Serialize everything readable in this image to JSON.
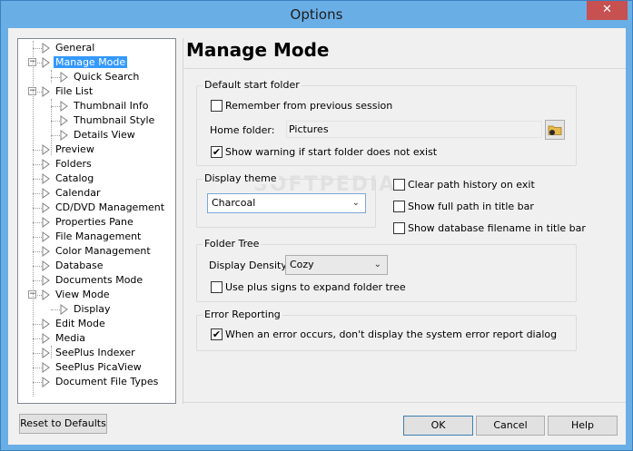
{
  "window": {
    "title": "Options",
    "close_glyph": "✕"
  },
  "tree": [
    {
      "label": "General",
      "level": 0
    },
    {
      "label": "Manage Mode",
      "level": 0,
      "selected": true,
      "expanded": true
    },
    {
      "label": "Quick Search",
      "level": 1
    },
    {
      "label": "File List",
      "level": 0,
      "expanded": true
    },
    {
      "label": "Thumbnail Info",
      "level": 1
    },
    {
      "label": "Thumbnail Style",
      "level": 1
    },
    {
      "label": "Details View",
      "level": 1
    },
    {
      "label": "Preview",
      "level": 0
    },
    {
      "label": "Folders",
      "level": 0
    },
    {
      "label": "Catalog",
      "level": 0
    },
    {
      "label": "Calendar",
      "level": 0
    },
    {
      "label": "CD/DVD Management",
      "level": 0
    },
    {
      "label": "Properties Pane",
      "level": 0
    },
    {
      "label": "File Management",
      "level": 0
    },
    {
      "label": "Color Management",
      "level": 0
    },
    {
      "label": "Database",
      "level": 0
    },
    {
      "label": "Documents Mode",
      "level": 0
    },
    {
      "label": "View Mode",
      "level": 0,
      "expanded": true
    },
    {
      "label": "Display",
      "level": 1
    },
    {
      "label": "Edit Mode",
      "level": 0
    },
    {
      "label": "Media",
      "level": 0
    },
    {
      "label": "SeePlus Indexer",
      "level": 0
    },
    {
      "label": "SeePlus PicaView",
      "level": 0
    },
    {
      "label": "Document File Types",
      "level": 0
    }
  ],
  "panel": {
    "heading": "Manage Mode",
    "start_folder": {
      "title": "Default start folder",
      "remember_label": "Remember from previous session",
      "remember_checked": false,
      "home_label": "Home folder:",
      "home_value": "Pictures",
      "warn_label": "Show warning if start folder does not exist",
      "warn_checked": true
    },
    "display_theme": {
      "title": "Display theme",
      "value": "Charcoal"
    },
    "options": {
      "clear_history_label": "Clear path history on exit",
      "clear_history_checked": false,
      "full_path_label": "Show full path in title bar",
      "full_path_checked": false,
      "db_filename_label": "Show database filename in title bar",
      "db_filename_checked": false
    },
    "folder_tree": {
      "title": "Folder Tree",
      "density_label": "Display Density:",
      "density_value": "Cozy",
      "plus_signs_label": "Use plus signs to expand folder tree",
      "plus_signs_checked": false
    },
    "error_reporting": {
      "title": "Error Reporting",
      "suppress_label": "When an error occurs, don't display the system error report dialog",
      "suppress_checked": true
    }
  },
  "buttons": {
    "reset": "Reset to Defaults",
    "ok": "OK",
    "cancel": "Cancel",
    "help": "Help"
  },
  "watermark": "SOFTPEDIA",
  "check_glyph": "✔",
  "dropdown_glyph": "⌄"
}
